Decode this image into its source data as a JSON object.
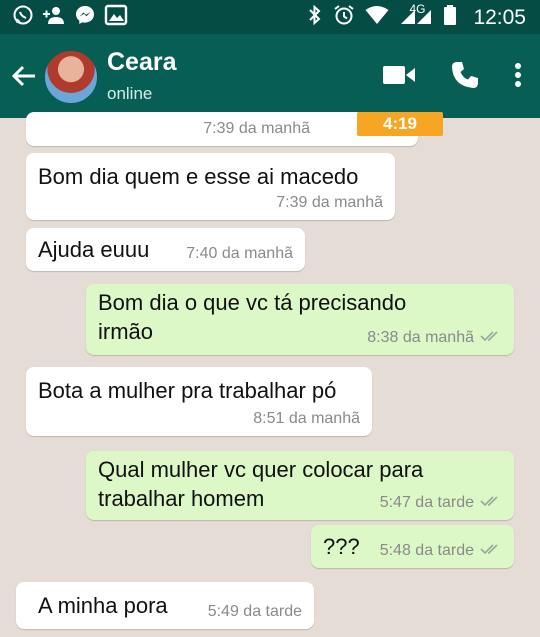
{
  "status_bar": {
    "time": "12:05",
    "network": "4G",
    "left_icons": [
      "whatsapp-icon",
      "add-person-icon",
      "messenger-icon",
      "gallery-icon"
    ],
    "right_icons": [
      "bluetooth-icon",
      "alarm-icon",
      "wifi-icon",
      "signal-icon",
      "battery-icon"
    ]
  },
  "header": {
    "contact_name": "Ceara",
    "status": "online",
    "icons": [
      "back-arrow-icon",
      "video-call-icon",
      "phone-call-icon",
      "more-options-icon"
    ]
  },
  "messages": [
    {
      "type": "in",
      "text": "",
      "time": "7:39 da manhã",
      "badge": "4:19"
    },
    {
      "type": "in",
      "text": "Bom dia quem e esse ai macedo",
      "time": "7:39 da manhã"
    },
    {
      "type": "in",
      "text": "Ajuda euuu",
      "time": "7:40 da manhã"
    },
    {
      "type": "out",
      "text_line1": "Bom dia o que vc tá precisando",
      "text_line2": "irmão",
      "time": "8:38 da manhã",
      "read": true
    },
    {
      "type": "in",
      "text": "Bota a mulher pra trabalhar pó",
      "time": "8:51 da manhã"
    },
    {
      "type": "out",
      "text_line1": "Qual mulher vc quer colocar para",
      "text_line2": "trabalhar homem",
      "time": "5:47 da tarde",
      "read": true
    },
    {
      "type": "out",
      "text": "???",
      "time": "5:48 da tarde",
      "read": true
    },
    {
      "type": "in",
      "text": "A minha pora",
      "time": "5:49 da tarde"
    }
  ],
  "colors": {
    "status_bar": "#054d44",
    "app_bar": "#075e54",
    "chat_bg": "#e5ddd5",
    "incoming_bubble": "#ffffff",
    "outgoing_bubble": "#dcf8c6",
    "badge": "#f6a623",
    "read_ticks": "#9aa7a0"
  }
}
